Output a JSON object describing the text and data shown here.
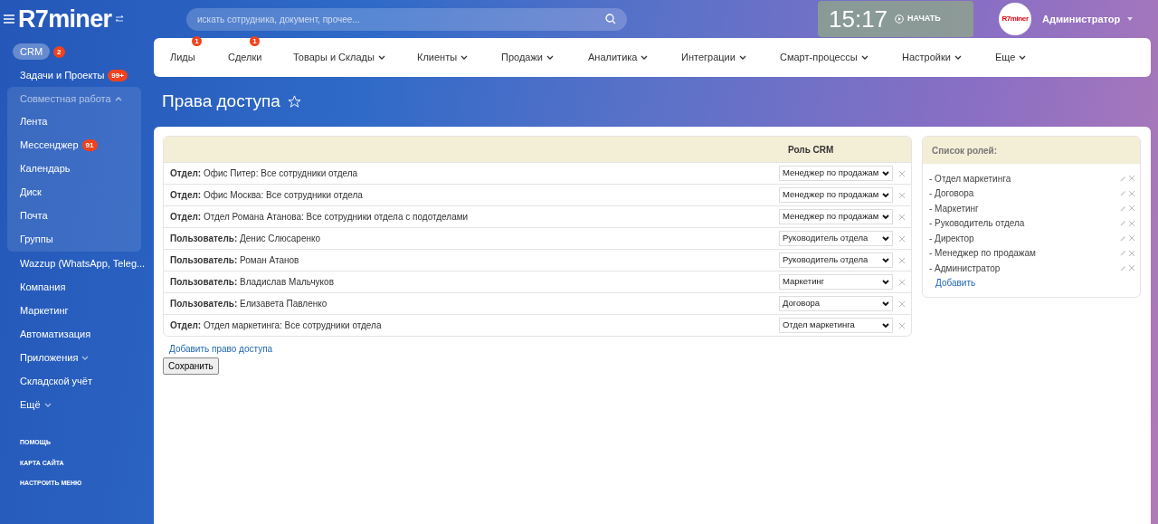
{
  "header": {
    "logo": "R7miner",
    "search": {
      "placeholder": "искать сотрудника, документ, прочее..."
    },
    "timer": {
      "time": "15:17",
      "action": "НАЧАТЬ"
    },
    "user": {
      "avatar_text": "R7miner",
      "name": "Администратор"
    }
  },
  "sidebar": {
    "items": [
      {
        "label": "CRM",
        "badge": "2",
        "selected": true
      },
      {
        "label": "Задачи и Проекты",
        "badge": "99+",
        "selected": false
      },
      {
        "label": "Совместная работа",
        "kind": "group",
        "expanded": true,
        "selected": false,
        "children": [
          {
            "label": "Лента",
            "selected": false
          },
          {
            "label": "Мессенджер",
            "badge": "91",
            "selected": false
          },
          {
            "label": "Календарь",
            "selected": false
          },
          {
            "label": "Диск",
            "selected": false
          },
          {
            "label": "Почта",
            "selected": false
          },
          {
            "label": "Группы",
            "selected": false
          }
        ]
      },
      {
        "label": "Wazzup (WhatsApp, Teleg...",
        "selected": false
      },
      {
        "label": "Компания",
        "selected": false
      },
      {
        "label": "Маркетинг",
        "selected": false
      },
      {
        "label": "Автоматизация",
        "selected": false
      },
      {
        "label": "Приложения",
        "kind": "dropdown",
        "selected": false
      },
      {
        "label": "Складской учёт",
        "selected": false
      },
      {
        "label": "Ещё",
        "kind": "dropdown",
        "selected": false
      }
    ],
    "footer_links": [
      "ПОМОЩЬ",
      "КАРТА САЙТА",
      "НАСТРОИТЬ МЕНЮ"
    ]
  },
  "top_menu": [
    {
      "label": "Лиды",
      "badge": "1"
    },
    {
      "label": "Сделки",
      "badge": "1"
    },
    {
      "label": "Товары и Склады",
      "dropdown": true
    },
    {
      "label": "Клиенты",
      "dropdown": true
    },
    {
      "label": "Продажи",
      "dropdown": true
    },
    {
      "label": "Аналитика",
      "dropdown": true
    },
    {
      "label": "Интеграции",
      "dropdown": true
    },
    {
      "label": "Смарт-процессы",
      "dropdown": true
    },
    {
      "label": "Настройки",
      "dropdown": true
    },
    {
      "label": "Еще",
      "dropdown": true
    }
  ],
  "page_title": "Права доступа",
  "access_table": {
    "columns": [
      "Роль CRM"
    ],
    "rows": [
      {
        "subject": "**Отдел:** Офис Питер: Все сотрудники отдела",
        "role": "Менеджер по продажам"
      },
      {
        "subject": "**Отдел:** Офис Москва: Все сотрудники отдела",
        "role": "Менеджер по продажам"
      },
      {
        "subject": "**Отдел:** Отдел Романа Атанова: Все сотрудники отдела с подотделами",
        "role": "Менеджер по продажам"
      },
      {
        "subject": "**Пользователь:** Денис Слюсаренко",
        "role": "Руководитель отдела"
      },
      {
        "subject": "**Пользователь:** Роман Атанов",
        "role": "Руководитель отдела"
      },
      {
        "subject": "**Пользователь:** Владислав Мальчуков",
        "role": "Маркетинг"
      },
      {
        "subject": "**Пользователь:** Елизавета Павленко",
        "role": "Договора"
      },
      {
        "subject": "**Отдел:** Отдел маркетинга: Все сотрудники отдела",
        "role": "Отдел маркетинга"
      }
    ],
    "add_link": "Добавить право доступа",
    "save_button": "Сохранить"
  },
  "roles_panel": {
    "title": "Список ролей:",
    "roles": [
      "- Отдел маркетинга",
      "- Договора",
      "- Маркетинг",
      "- Руководитель отдела",
      "- Директор",
      "- Менеджер по продажам",
      "- Администратор"
    ],
    "add_link": "Добавить"
  }
}
